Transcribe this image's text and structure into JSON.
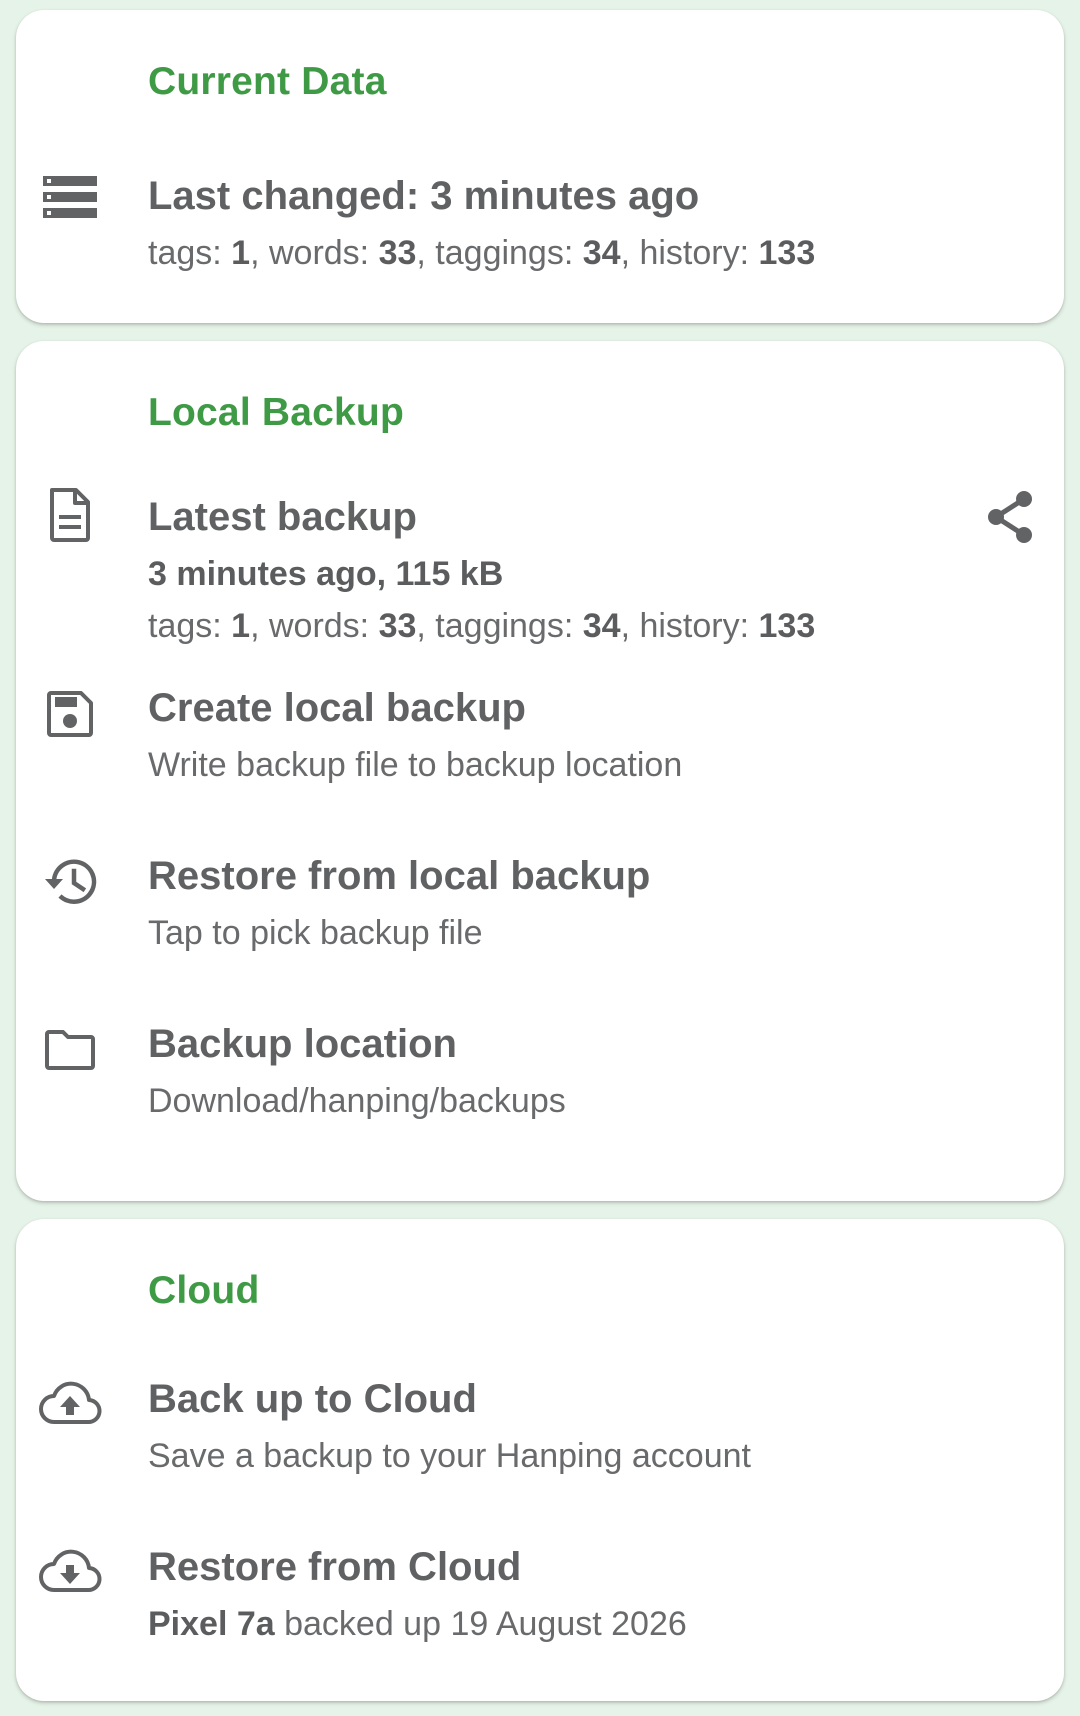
{
  "current_data": {
    "section_title": "Current Data",
    "last_changed": "Last changed: 3 minutes ago",
    "stats": {
      "tags_label": "tags: ",
      "tags": "1",
      "words_label": ", words: ",
      "words": "33",
      "taggings_label": ", taggings: ",
      "taggings": "34",
      "history_label": ", history: ",
      "history": "133"
    }
  },
  "local_backup": {
    "section_title": "Local Backup",
    "latest": {
      "title": "Latest backup",
      "age_size": "3 minutes ago, 115 kB",
      "stats": {
        "tags_label": "tags: ",
        "tags": "1",
        "words_label": ", words: ",
        "words": "33",
        "taggings_label": ", taggings: ",
        "taggings": "34",
        "history_label": ", history: ",
        "history": "133"
      }
    },
    "create": {
      "title": "Create local backup",
      "subtitle": "Write backup file to backup location"
    },
    "restore": {
      "title": "Restore from local backup",
      "subtitle": "Tap to pick backup file"
    },
    "location": {
      "title": "Backup location",
      "subtitle": "Download/hanping/backups"
    }
  },
  "cloud": {
    "section_title": "Cloud",
    "backup": {
      "title": "Back up to Cloud",
      "subtitle": "Save a backup to your Hanping account"
    },
    "restore": {
      "title": "Restore from Cloud",
      "device": "Pixel 7a",
      "subtitle_rest": " backed up 19 August 2026"
    }
  },
  "colors": {
    "accent": "#3f9a45",
    "background": "#e6f3e8",
    "card": "#ffffff",
    "text_primary": "#5f6163",
    "icon": "#616365"
  },
  "icons": {
    "current_data": "storage-icon",
    "latest_backup": "file-document-icon",
    "share": "share-icon",
    "create_backup": "save-icon",
    "restore_backup": "history-icon",
    "location": "folder-icon",
    "cloud_upload": "cloud-upload-icon",
    "cloud_download": "cloud-download-icon"
  }
}
